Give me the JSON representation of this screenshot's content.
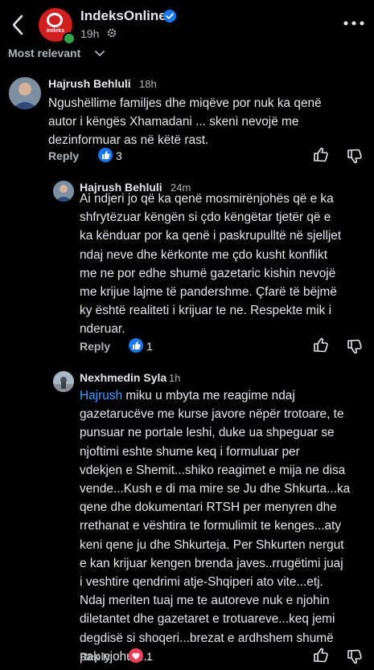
{
  "header": {
    "page_name": "IndeksOnline",
    "logo_text": "indeks",
    "time": "19h",
    "sort_label": "Most relevant"
  },
  "comments": [
    {
      "author": "Hajrush Behluli",
      "time": "18h",
      "lines": [
        "Ngushëllime familjes dhe miqëve por nuk ka qenë",
        "autor i këngës Xhamadani ... skeni nevojë me",
        "dezinformuar as në këtë rast."
      ],
      "reply_label": "Reply",
      "reaction_type": "like",
      "reaction_count": "3"
    },
    {
      "author": "Hajrush Behluli",
      "time": "24m",
      "lines": [
        "Ai ndjeri jo që ka qenë mosmirënjohës që e ka",
        "shfrytëzuar këngën si çdo këngëtar tjetër që e",
        "ka kënduar por ka qenë i paskrupulltë në sjelljet",
        "ndaj neve dhe kërkonte me çdo kusht  konflikt",
        "me ne por edhe shumë gazetaric kishin nevojë",
        "me krijue lajme të pandershme. Çfarë të bëjmë",
        "ky është realiteti i krijuar te ne. Respekte mik i",
        "nderuar."
      ],
      "reply_label": "Reply",
      "reaction_type": "like",
      "reaction_count": "1"
    },
    {
      "author": "Nexhmedin Syla",
      "time": "1h",
      "mention": "Hajrush",
      "first_line_rest": " miku u mbyta me reagime ndaj",
      "lines": [
        "gazetarucëve me kurse javore nëpër trotoare, te",
        "punsuar ne portale leshi, duke ua shpeguar se",
        "njoftimi eshte shume keq i formuluar per",
        "vdekjen e Shemit...shiko reagimet e mija ne disa",
        "vende...Kush e di ma mire se Ju dhe Shkurta...ka",
        "qene dhe dokumentari RTSH per menyren dhe",
        "rrethanat e vështira te formulimit te kenges...aty",
        "keni qene ju dhe Shkurteja. Per Shkurten nergut",
        "e kan krijuar kengen brenda javes..rrugëtimi juaj",
        "i veshtire qendrimi atje-Shqiperi ato vite...etj.",
        "Ndaj meriten tuaj me te autoreve nuk e njohin",
        "diletantet dhe gazetaret e trotuareve...keq jemi",
        "degdisë si shoqeri...brezat e ardhshem shumë",
        "pak njohuri..."
      ],
      "reply_label": "Reply",
      "reaction_type": "love",
      "reaction_count": "1"
    }
  ],
  "colors": {
    "background": "#000000",
    "text": "#e4e6eb",
    "secondary": "#b0b3b8",
    "like_blue": "#1877f2",
    "love_red": "#f33e58",
    "mention_blue": "#4599ff",
    "online_green": "#31a24c"
  }
}
